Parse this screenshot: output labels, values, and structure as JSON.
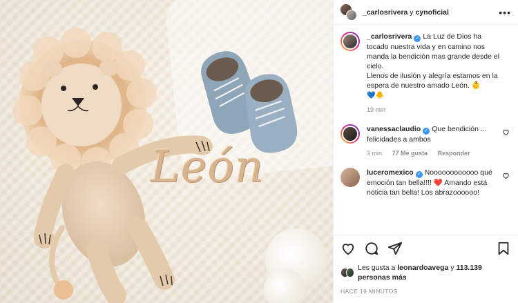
{
  "header": {
    "user1": "_carlosrivera",
    "conj": " y ",
    "user2": "cynoficial",
    "more": "•••"
  },
  "photo": {
    "embroidered_name": "León"
  },
  "caption": {
    "username": "_carlosrivera",
    "verified_mark": "✓",
    "text": "La Luz de Dios ha tocado nuestra vida y en camino nos manda la bendición mas grande desde el cielo.",
    "text2": "Llenos de ilusión y alegría estamos en la espera de nuestro amado León. 👶",
    "emojis": "💙🐥",
    "time": "19 min"
  },
  "comments": [
    {
      "username": "vanessaclaudio",
      "text": "Que bendición ... felicidades a ambos",
      "time": "3 min",
      "likes": "77 Me gusta",
      "reply": "Responder"
    },
    {
      "username": "luceromexico",
      "text": "Noooooooooooo qué emoción tan bella!!!! ❤️ Amando está noticia tan bella! Los abrazoooooo!"
    }
  ],
  "actions": {
    "like_icon": "heart-outline-icon",
    "comment_icon": "comment-icon",
    "share_icon": "share-icon",
    "save_icon": "bookmark-icon"
  },
  "likes": {
    "prefix": "Les gusta a ",
    "user": "leonardoavega",
    "middle": " y ",
    "count": "113.139",
    "suffix": " personas más"
  },
  "timestamp": "HACE 19 MINUTOS",
  "colors": {
    "verified": "#3897f0",
    "meta_gray": "#8e8e8e",
    "text": "#262626"
  }
}
